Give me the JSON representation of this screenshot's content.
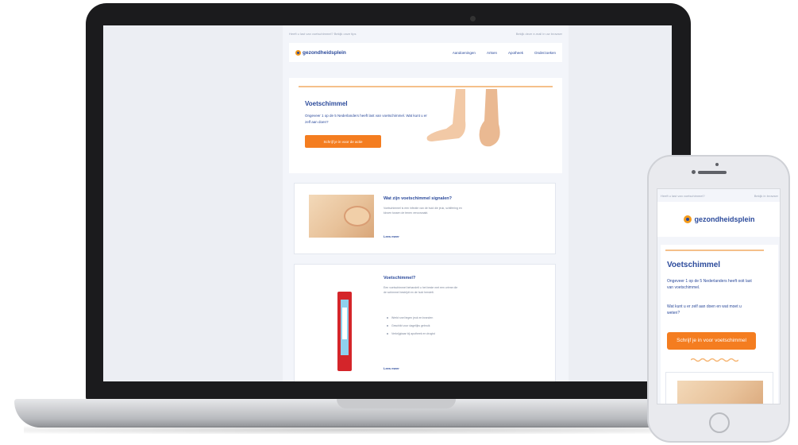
{
  "laptop": {
    "preheader_left": "Heeft u last van voetschimmel? Bekijk onze tips",
    "preheader_right": "Bekijk deze e-mail in uw browser",
    "logo_text": "gezondheidsplein",
    "nav": [
      "Aandoeningen",
      "Artsen",
      "Apotheek",
      "Onderzoeken"
    ],
    "hero": {
      "title": "Voetschimmel",
      "text": "Ongeveer 1 op de 5 Nederlanders heeft last van voetschimmel. Wat kunt u er zelf aan doen?",
      "button": "Schrijf je in voor de actie"
    },
    "card1": {
      "title": "Wat zijn voetschimmel signalen?",
      "body": "Voetschimmel is een infectie van de huid die jeuk, schilfering en kloven tussen de tenen veroorzaakt.",
      "link": "Lees meer"
    },
    "card2": {
      "title": "Voetschimmel?",
      "body": "Een voetschimmel behandelt u het beste met een crème die de schimmel bestrijdt en de huid herstelt.",
      "bullets": [
        "Werkt snel tegen jeuk en branden",
        "Geschikt voor dagelijks gebruik",
        "Verkrijgbaar bij apotheek en drogist"
      ],
      "link": "Lees meer"
    }
  },
  "phone": {
    "preheader_left": "Heeft u last van voetschimmel?",
    "preheader_right": "Bekijk in browser",
    "logo_text": "gezondheidsplein",
    "title": "Voetschimmel",
    "text1": "Ongeveer 1 op de 5 Nederlanders heeft ooit last van voetschimmel.",
    "text2": "Wat kunt u er zelf aan doen en wat moet u weten?",
    "button": "Schrijf je in voor voetschimmel"
  },
  "colors": {
    "brand_blue": "#2b4a9b",
    "accent_orange": "#f47d20"
  }
}
